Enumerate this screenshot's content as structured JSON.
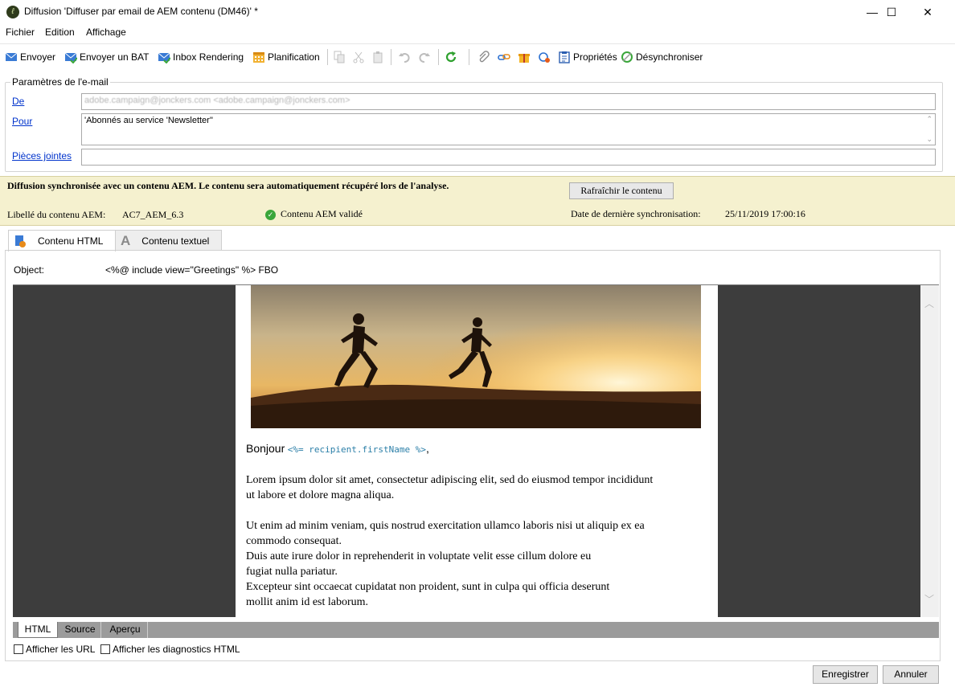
{
  "window": {
    "title": "Diffusion 'Diffuser par email de AEM contenu (DM46)' *",
    "controls": {
      "minimize": "—",
      "maximize": "☐",
      "close": "✕"
    }
  },
  "menu": {
    "file": "Fichier",
    "edit": "Edition",
    "view": "Affichage"
  },
  "toolbar": {
    "send": "Envoyer",
    "send_proof": "Envoyer un BAT",
    "inbox_rendering": "Inbox Rendering",
    "schedule": "Planification",
    "properties": "Propriétés",
    "unsync": "Désynchroniser"
  },
  "email_params": {
    "legend": "Paramètres de l'e-mail",
    "from_label": "De",
    "from_value": "adobe.campaign@jonckers.com <adobe.campaign@jonckers.com>",
    "to_label": "Pour",
    "to_value": "'Abonnés au service 'Newsletter''",
    "attachments_label": "Pièces jointes",
    "attachments_value": ""
  },
  "aem": {
    "sync_message": "Diffusion synchronisée avec un contenu AEM. Le contenu sera automatiquement récupéré lors de l'analyse.",
    "refresh_button": "Rafraîchir le contenu",
    "content_label_caption": "Libellé du contenu AEM:",
    "content_label_value": "AC7_AEM_6.3",
    "validated": "Contenu AEM validé",
    "last_sync_caption": "Date de dernière synchronisation:",
    "last_sync_value": "25/11/2019 17:00:16"
  },
  "tabs": {
    "html": "Contenu HTML",
    "text": "Contenu textuel"
  },
  "object": {
    "label": "Object:",
    "value": "<%@ include view=\"Greetings\" %> FBO"
  },
  "email": {
    "greeting": "Bonjour",
    "greeting_tag": "<%= recipient.firstName %>",
    "greeting_end": ",",
    "para1_line1": "Lorem ipsum dolor sit amet, consectetur adipiscing elit, sed do eiusmod tempor incididunt",
    "para1_line2": "ut labore et dolore magna aliqua.",
    "para2_line1": "Ut enim ad minim veniam, quis nostrud exercitation ullamco laboris nisi ut aliquip ex ea",
    "para2_line2": "commodo consequat.",
    "para2_line3": "Duis aute irure dolor in reprehenderit in voluptate velit esse cillum dolore eu",
    "para2_line4": "fugiat nulla pariatur.",
    "para2_line5": "Excepteur sint occaecat cupidatat non proident, sunt in culpa qui officia deserunt",
    "para2_line6": "mollit anim id est laborum."
  },
  "view_tabs": {
    "html": "HTML",
    "source": "Source",
    "preview": "Aperçu"
  },
  "options": {
    "show_urls": "Afficher les URL",
    "show_diagnostics": "Afficher les diagnostics HTML"
  },
  "footer": {
    "save": "Enregistrer",
    "cancel": "Annuler"
  },
  "colors": {
    "aem_banner": "#f5f1cf",
    "preview_bg": "#3d3d3d",
    "link": "#0033cc",
    "ok_green": "#3aa63a"
  }
}
